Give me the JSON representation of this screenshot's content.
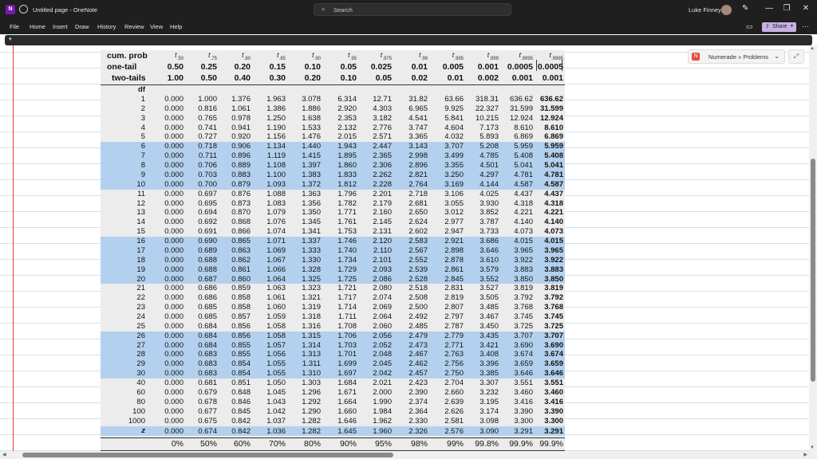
{
  "titlebar": {
    "app_icon": "onenote-icon",
    "app_letter": "N",
    "title": "Untitled page - OneNote",
    "search_placeholder": "Search",
    "user_name": "Luke Finney",
    "minimize": "—",
    "maximize": "❐",
    "close": "✕"
  },
  "menubar": {
    "items": [
      "File",
      "Home",
      "Insert",
      "Draw",
      "History",
      "Review",
      "View",
      "Help"
    ],
    "share_label": "Share"
  },
  "popup": {
    "label": "Numerade » Problems"
  },
  "table": {
    "header_rows": [
      {
        "label": "cum. prob",
        "values": [
          ".50",
          ".75",
          ".80",
          ".85",
          ".90",
          ".95",
          ".975",
          ".99",
          ".995",
          ".999",
          ".9995",
          ".9995"
        ]
      },
      {
        "label": "one-tail",
        "values": [
          "0.50",
          "0.25",
          "0.20",
          "0.15",
          "0.10",
          "0.05",
          "0.025",
          "0.01",
          "0.005",
          "0.001",
          "0.0005",
          "0.0005"
        ]
      },
      {
        "label": "two-tails",
        "values": [
          "1.00",
          "0.50",
          "0.40",
          "0.30",
          "0.20",
          "0.10",
          "0.05",
          "0.02",
          "0.01",
          "0.002",
          "0.001",
          "0.001"
        ]
      }
    ],
    "df_label": "df",
    "rows": [
      {
        "df": "1",
        "v": [
          "0.000",
          "1.000",
          "1.376",
          "1.963",
          "3.078",
          "6.314",
          "12.71",
          "31.82",
          "63.66",
          "318.31",
          "636.62",
          "636.62"
        ],
        "hl": false
      },
      {
        "df": "2",
        "v": [
          "0.000",
          "0.816",
          "1.061",
          "1.386",
          "1.886",
          "2.920",
          "4.303",
          "6.965",
          "9.925",
          "22.327",
          "31.599",
          "31.599"
        ],
        "hl": false
      },
      {
        "df": "3",
        "v": [
          "0.000",
          "0.765",
          "0.978",
          "1.250",
          "1.638",
          "2.353",
          "3.182",
          "4.541",
          "5.841",
          "10.215",
          "12.924",
          "12.924"
        ],
        "hl": false
      },
      {
        "df": "4",
        "v": [
          "0.000",
          "0.741",
          "0.941",
          "1.190",
          "1.533",
          "2.132",
          "2.776",
          "3.747",
          "4.604",
          "7.173",
          "8.610",
          "8.610"
        ],
        "hl": false
      },
      {
        "df": "5",
        "v": [
          "0.000",
          "0.727",
          "0.920",
          "1.156",
          "1.476",
          "2.015",
          "2.571",
          "3.365",
          "4.032",
          "5.893",
          "6.869",
          "6.869"
        ],
        "hl": false
      },
      {
        "df": "6",
        "v": [
          "0.000",
          "0.718",
          "0.906",
          "1.134",
          "1.440",
          "1.943",
          "2.447",
          "3.143",
          "3.707",
          "5.208",
          "5.959",
          "5.959"
        ],
        "hl": true
      },
      {
        "df": "7",
        "v": [
          "0.000",
          "0.711",
          "0.896",
          "1.119",
          "1.415",
          "1.895",
          "2.365",
          "2.998",
          "3.499",
          "4.785",
          "5.408",
          "5.408"
        ],
        "hl": true
      },
      {
        "df": "8",
        "v": [
          "0.000",
          "0.706",
          "0.889",
          "1.108",
          "1.397",
          "1.860",
          "2.306",
          "2.896",
          "3.355",
          "4.501",
          "5.041",
          "5.041"
        ],
        "hl": true
      },
      {
        "df": "9",
        "v": [
          "0.000",
          "0.703",
          "0.883",
          "1.100",
          "1.383",
          "1.833",
          "2.262",
          "2.821",
          "3.250",
          "4.297",
          "4.781",
          "4.781"
        ],
        "hl": true
      },
      {
        "df": "10",
        "v": [
          "0.000",
          "0.700",
          "0.879",
          "1.093",
          "1.372",
          "1.812",
          "2.228",
          "2.764",
          "3.169",
          "4.144",
          "4.587",
          "4.587"
        ],
        "hl": true
      },
      {
        "df": "11",
        "v": [
          "0.000",
          "0.697",
          "0.876",
          "1.088",
          "1.363",
          "1.796",
          "2.201",
          "2.718",
          "3.106",
          "4.025",
          "4.437",
          "4.437"
        ],
        "hl": false
      },
      {
        "df": "12",
        "v": [
          "0.000",
          "0.695",
          "0.873",
          "1.083",
          "1.356",
          "1.782",
          "2.179",
          "2.681",
          "3.055",
          "3.930",
          "4.318",
          "4.318"
        ],
        "hl": false
      },
      {
        "df": "13",
        "v": [
          "0.000",
          "0.694",
          "0.870",
          "1.079",
          "1.350",
          "1.771",
          "2.160",
          "2.650",
          "3.012",
          "3.852",
          "4.221",
          "4.221"
        ],
        "hl": false
      },
      {
        "df": "14",
        "v": [
          "0.000",
          "0.692",
          "0.868",
          "1.076",
          "1.345",
          "1.761",
          "2.145",
          "2.624",
          "2.977",
          "3.787",
          "4.140",
          "4.140"
        ],
        "hl": false
      },
      {
        "df": "15",
        "v": [
          "0.000",
          "0.691",
          "0.866",
          "1.074",
          "1.341",
          "1.753",
          "2.131",
          "2.602",
          "2.947",
          "3.733",
          "4.073",
          "4.073"
        ],
        "hl": false
      },
      {
        "df": "16",
        "v": [
          "0.000",
          "0.690",
          "0.865",
          "1.071",
          "1.337",
          "1.746",
          "2.120",
          "2.583",
          "2.921",
          "3.686",
          "4.015",
          "4.015"
        ],
        "hl": true
      },
      {
        "df": "17",
        "v": [
          "0.000",
          "0.689",
          "0.863",
          "1.069",
          "1.333",
          "1.740",
          "2.110",
          "2.567",
          "2.898",
          "3.646",
          "3.965",
          "3.965"
        ],
        "hl": true
      },
      {
        "df": "18",
        "v": [
          "0.000",
          "0.688",
          "0.862",
          "1.067",
          "1.330",
          "1.734",
          "2.101",
          "2.552",
          "2.878",
          "3.610",
          "3.922",
          "3.922"
        ],
        "hl": true
      },
      {
        "df": "19",
        "v": [
          "0.000",
          "0.688",
          "0.861",
          "1.066",
          "1.328",
          "1.729",
          "2.093",
          "2.539",
          "2.861",
          "3.579",
          "3.883",
          "3.883"
        ],
        "hl": true
      },
      {
        "df": "20",
        "v": [
          "0.000",
          "0.687",
          "0.860",
          "1.064",
          "1.325",
          "1.725",
          "2.086",
          "2.528",
          "2.845",
          "3.552",
          "3.850",
          "3.850"
        ],
        "hl": true
      },
      {
        "df": "21",
        "v": [
          "0.000",
          "0.686",
          "0.859",
          "1.063",
          "1.323",
          "1.721",
          "2.080",
          "2.518",
          "2.831",
          "3.527",
          "3.819",
          "3.819"
        ],
        "hl": false
      },
      {
        "df": "22",
        "v": [
          "0.000",
          "0.686",
          "0.858",
          "1.061",
          "1.321",
          "1.717",
          "2.074",
          "2.508",
          "2.819",
          "3.505",
          "3.792",
          "3.792"
        ],
        "hl": false
      },
      {
        "df": "23",
        "v": [
          "0.000",
          "0.685",
          "0.858",
          "1.060",
          "1.319",
          "1.714",
          "2.069",
          "2.500",
          "2.807",
          "3.485",
          "3.768",
          "3.768"
        ],
        "hl": false
      },
      {
        "df": "24",
        "v": [
          "0.000",
          "0.685",
          "0.857",
          "1.059",
          "1.318",
          "1.711",
          "2.064",
          "2.492",
          "2.797",
          "3.467",
          "3.745",
          "3.745"
        ],
        "hl": false
      },
      {
        "df": "25",
        "v": [
          "0.000",
          "0.684",
          "0.856",
          "1.058",
          "1.316",
          "1.708",
          "2.060",
          "2.485",
          "2.787",
          "3.450",
          "3.725",
          "3.725"
        ],
        "hl": false
      },
      {
        "df": "26",
        "v": [
          "0.000",
          "0.684",
          "0.856",
          "1.058",
          "1.315",
          "1.706",
          "2.056",
          "2.479",
          "2.779",
          "3.435",
          "3.707",
          "3.707"
        ],
        "hl": true
      },
      {
        "df": "27",
        "v": [
          "0.000",
          "0.684",
          "0.855",
          "1.057",
          "1.314",
          "1.703",
          "2.052",
          "2.473",
          "2.771",
          "3.421",
          "3.690",
          "3.690"
        ],
        "hl": true
      },
      {
        "df": "28",
        "v": [
          "0.000",
          "0.683",
          "0.855",
          "1.056",
          "1.313",
          "1.701",
          "2.048",
          "2.467",
          "2.763",
          "3.408",
          "3.674",
          "3.674"
        ],
        "hl": true
      },
      {
        "df": "29",
        "v": [
          "0.000",
          "0.683",
          "0.854",
          "1.055",
          "1.311",
          "1.699",
          "2.045",
          "2.462",
          "2.756",
          "3.396",
          "3.659",
          "3.659"
        ],
        "hl": true
      },
      {
        "df": "30",
        "v": [
          "0.000",
          "0.683",
          "0.854",
          "1.055",
          "1.310",
          "1.697",
          "2.042",
          "2.457",
          "2.750",
          "3.385",
          "3.646",
          "3.646"
        ],
        "hl": true
      },
      {
        "df": "40",
        "v": [
          "0.000",
          "0.681",
          "0.851",
          "1.050",
          "1.303",
          "1.684",
          "2.021",
          "2.423",
          "2.704",
          "3.307",
          "3.551",
          "3.551"
        ],
        "hl": false
      },
      {
        "df": "60",
        "v": [
          "0.000",
          "0.679",
          "0.848",
          "1.045",
          "1.296",
          "1.671",
          "2.000",
          "2.390",
          "2.660",
          "3.232",
          "3.460",
          "3.460"
        ],
        "hl": false
      },
      {
        "df": "80",
        "v": [
          "0.000",
          "0.678",
          "0.846",
          "1.043",
          "1.292",
          "1.664",
          "1.990",
          "2.374",
          "2.639",
          "3.195",
          "3.416",
          "3.416"
        ],
        "hl": false
      },
      {
        "df": "100",
        "v": [
          "0.000",
          "0.677",
          "0.845",
          "1.042",
          "1.290",
          "1.660",
          "1.984",
          "2.364",
          "2.626",
          "3.174",
          "3.390",
          "3.390"
        ],
        "hl": false
      },
      {
        "df": "1000",
        "v": [
          "0.000",
          "0.675",
          "0.842",
          "1.037",
          "1.282",
          "1.646",
          "1.962",
          "2.330",
          "2.581",
          "3.098",
          "3.300",
          "3.300"
        ],
        "hl": false
      }
    ],
    "z_row": {
      "label": "z",
      "v": [
        "0.000",
        "0.674",
        "0.842",
        "1.036",
        "1.282",
        "1.645",
        "1.960",
        "2.326",
        "2.576",
        "3.090",
        "3.291",
        "3.291"
      ]
    },
    "conf_row": [
      "0%",
      "50%",
      "60%",
      "70%",
      "80%",
      "90%",
      "95%",
      "98%",
      "99%",
      "99.8%",
      "99.9%",
      "99.9%"
    ]
  }
}
